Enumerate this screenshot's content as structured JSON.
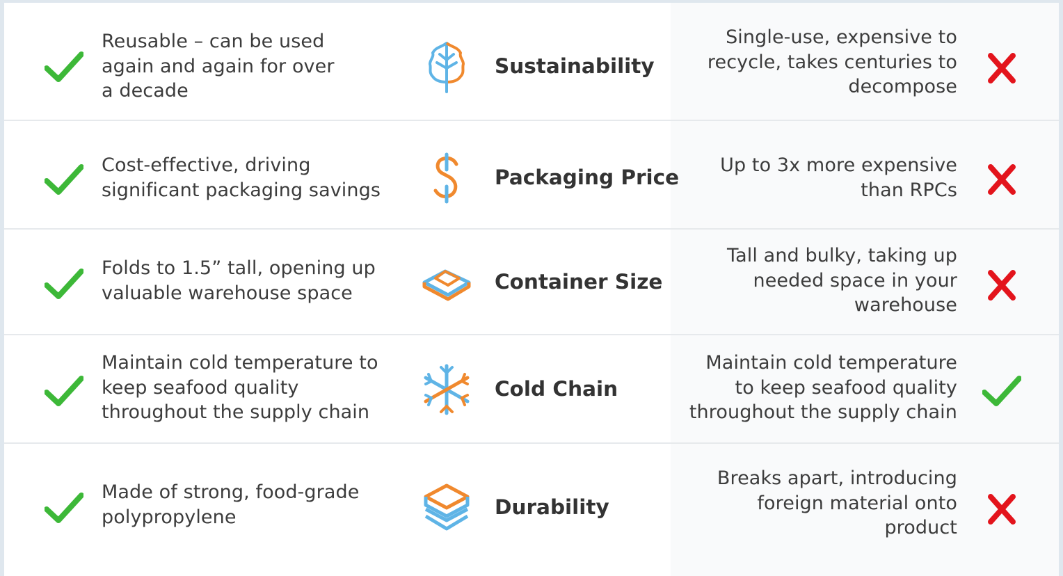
{
  "colors": {
    "check": "#3db838",
    "cross": "#e3141c",
    "icon_blue": "#5fb4e6",
    "icon_orange": "#f0892e"
  },
  "rows": [
    {
      "category": "Sustainability",
      "icon": "leaf-icon",
      "left_lines": [
        "Reusable – can be used",
        "again and again for over",
        "a decade"
      ],
      "right_lines": [
        "Single-use, expensive to",
        "recycle, takes centuries to",
        "decompose"
      ],
      "right_mark": "cross"
    },
    {
      "category": "Packaging Price",
      "icon": "dollar-icon",
      "left_lines": [
        "Cost-effective, driving",
        "significant packaging savings"
      ],
      "right_lines": [
        "Up to 3x more expensive",
        "than RPCs"
      ],
      "right_mark": "cross"
    },
    {
      "category": "Container Size",
      "icon": "folded-container-icon",
      "left_lines": [
        "Folds to 1.5” tall, opening up",
        "valuable warehouse space"
      ],
      "right_lines": [
        "Tall and bulky, taking up",
        "needed space in your",
        "warehouse"
      ],
      "right_mark": "cross"
    },
    {
      "category": "Cold Chain",
      "icon": "snowflake-icon",
      "left_lines": [
        "Maintain cold temperature to",
        "keep seafood quality",
        "throughout the supply chain"
      ],
      "right_lines": [
        "Maintain cold temperature",
        "to keep seafood quality",
        "throughout the supply chain"
      ],
      "right_mark": "check"
    },
    {
      "category": "Durability",
      "icon": "stacked-container-icon",
      "left_lines": [
        "Made of strong, food-grade",
        "polypropylene"
      ],
      "right_lines": [
        "Breaks apart, introducing",
        "foreign material onto",
        "product"
      ],
      "right_mark": "cross"
    }
  ]
}
